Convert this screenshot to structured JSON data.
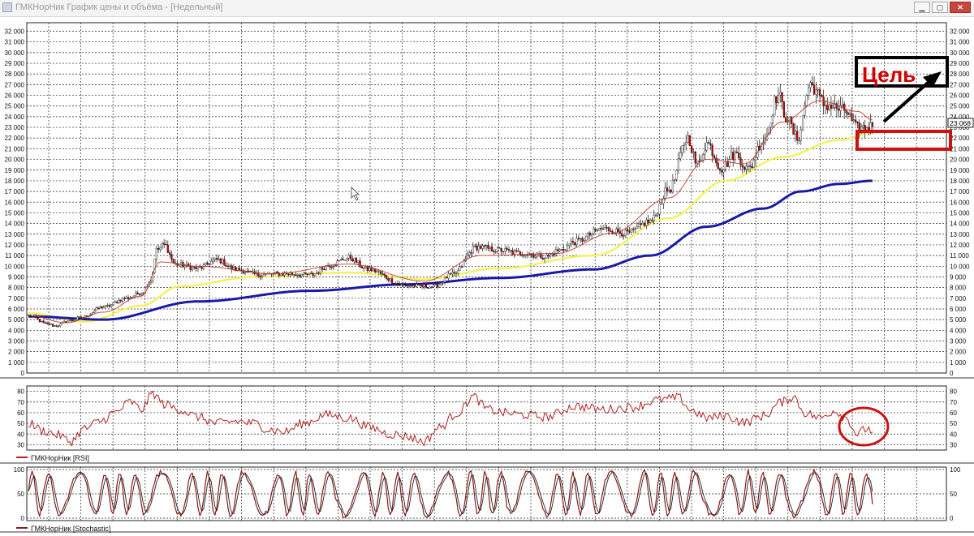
{
  "window": {
    "title": "ГМКНорНик График цены и объёма - [Недельный]",
    "minimize_glyph": "▁",
    "maximize_glyph": "▢",
    "close_glyph": "✕",
    "icon": "chart-window-icon"
  },
  "annotation": {
    "target_label": "Цель",
    "price_label": "23 068"
  },
  "colors": {
    "candle_up": "#ffffff",
    "candle_down": "#cc0000",
    "candle_wick": "#111111",
    "ma_short": "#c0392b",
    "ma_mid": "#f2f25a",
    "ma_long": "#1a1aa6",
    "rsi_line": "#b22222",
    "stoch_k": "#8b1a1a",
    "stoch_d": "#222222",
    "annotation": "#d10000",
    "grid": "#222222"
  },
  "chart_data": [
    {
      "type": "candlestick",
      "name": "price",
      "y_ticks": [
        0,
        1000,
        2000,
        3000,
        4000,
        5000,
        6000,
        7000,
        8000,
        9000,
        10000,
        11000,
        12000,
        13000,
        14000,
        15000,
        16000,
        17000,
        18000,
        19000,
        20000,
        21000,
        22000,
        23000,
        24000,
        25000,
        26000,
        27000,
        28000,
        29000,
        30000,
        31000,
        32000
      ],
      "y_tick_labels": [
        "0",
        "1 000",
        "2 000",
        "3 000",
        "4 000",
        "5 000",
        "6 000",
        "7 000",
        "8 000",
        "9 000",
        "10 000",
        "11 000",
        "12 000",
        "13 000",
        "14 000",
        "15 000",
        "16 000",
        "17 000",
        "18 000",
        "19 000",
        "20 000",
        "21 000",
        "22 000",
        "23 000",
        "24 000",
        "25 000",
        "26 000",
        "27 000",
        "28 000",
        "29 000",
        "30 000",
        "31 000",
        "32 000"
      ],
      "ylim": [
        0,
        32800
      ],
      "grid": true,
      "last_price": 23068,
      "close_anchors": [
        [
          0,
          5400
        ],
        [
          10,
          4600
        ],
        [
          14,
          4400
        ],
        [
          22,
          4900
        ],
        [
          28,
          5200
        ],
        [
          40,
          6200
        ],
        [
          52,
          7000
        ],
        [
          60,
          7500
        ],
        [
          65,
          8700
        ],
        [
          68,
          11500
        ],
        [
          72,
          12000
        ],
        [
          78,
          10200
        ],
        [
          90,
          9800
        ],
        [
          100,
          10600
        ],
        [
          110,
          9700
        ],
        [
          122,
          9200
        ],
        [
          135,
          9300
        ],
        [
          150,
          9200
        ],
        [
          160,
          10100
        ],
        [
          170,
          10800
        ],
        [
          180,
          9700
        ],
        [
          200,
          8200
        ],
        [
          215,
          8100
        ],
        [
          225,
          9200
        ],
        [
          238,
          11800
        ],
        [
          250,
          11500
        ],
        [
          262,
          11200
        ],
        [
          275,
          10900
        ],
        [
          282,
          11500
        ],
        [
          290,
          12300
        ],
        [
          305,
          13500
        ],
        [
          318,
          13100
        ],
        [
          330,
          14200
        ],
        [
          340,
          17200
        ],
        [
          350,
          22000
        ],
        [
          355,
          19500
        ],
        [
          360,
          21500
        ],
        [
          368,
          19200
        ],
        [
          375,
          20500
        ],
        [
          382,
          19100
        ],
        [
          390,
          21800
        ],
        [
          398,
          26000
        ],
        [
          402,
          24000
        ],
        [
          408,
          22000
        ],
        [
          415,
          27000
        ],
        [
          423,
          25100
        ],
        [
          433,
          24600
        ],
        [
          440,
          22900
        ],
        [
          448,
          23068
        ]
      ],
      "sma_short_anchors": [
        [
          0,
          5400
        ],
        [
          20,
          4700
        ],
        [
          40,
          5700
        ],
        [
          60,
          7200
        ],
        [
          70,
          10400
        ],
        [
          90,
          10000
        ],
        [
          130,
          9300
        ],
        [
          170,
          10200
        ],
        [
          210,
          8600
        ],
        [
          240,
          11000
        ],
        [
          280,
          11200
        ],
        [
          310,
          13100
        ],
        [
          340,
          16400
        ],
        [
          360,
          20000
        ],
        [
          380,
          19600
        ],
        [
          400,
          23500
        ],
        [
          420,
          25500
        ],
        [
          440,
          24500
        ],
        [
          448,
          23700
        ]
      ],
      "sma_mid_anchors": [
        [
          0,
          5600
        ],
        [
          30,
          4800
        ],
        [
          60,
          6300
        ],
        [
          80,
          8100
        ],
        [
          120,
          9000
        ],
        [
          170,
          9400
        ],
        [
          210,
          8800
        ],
        [
          250,
          9800
        ],
        [
          300,
          11000
        ],
        [
          340,
          14500
        ],
        [
          370,
          18000
        ],
        [
          400,
          20200
        ],
        [
          430,
          21800
        ],
        [
          448,
          22500
        ]
      ],
      "sma_long_anchors": [
        [
          0,
          5300
        ],
        [
          40,
          5000
        ],
        [
          90,
          6700
        ],
        [
          150,
          7700
        ],
        [
          200,
          8300
        ],
        [
          250,
          8900
        ],
        [
          300,
          9700
        ],
        [
          330,
          11000
        ],
        [
          360,
          13700
        ],
        [
          390,
          15400
        ],
        [
          410,
          17000
        ],
        [
          430,
          17700
        ],
        [
          448,
          18000
        ]
      ]
    },
    {
      "type": "line",
      "name": "rsi",
      "legend": "ГМКНорНик [RSI]",
      "y_ticks": [
        30,
        40,
        50,
        60,
        70,
        80
      ],
      "y_tick_labels": [
        "30",
        "40",
        "50",
        "60",
        "70",
        "80"
      ],
      "ylim": [
        25,
        85
      ],
      "anchors": [
        [
          0,
          50
        ],
        [
          8,
          43
        ],
        [
          16,
          39
        ],
        [
          22,
          33
        ],
        [
          30,
          45
        ],
        [
          38,
          52
        ],
        [
          46,
          60
        ],
        [
          54,
          70
        ],
        [
          60,
          63
        ],
        [
          66,
          78
        ],
        [
          72,
          68
        ],
        [
          80,
          63
        ],
        [
          90,
          56
        ],
        [
          100,
          50
        ],
        [
          110,
          52
        ],
        [
          120,
          50
        ],
        [
          128,
          44
        ],
        [
          136,
          42
        ],
        [
          146,
          50
        ],
        [
          158,
          58
        ],
        [
          170,
          55
        ],
        [
          182,
          46
        ],
        [
          192,
          40
        ],
        [
          200,
          38
        ],
        [
          210,
          33
        ],
        [
          218,
          46
        ],
        [
          228,
          60
        ],
        [
          236,
          75
        ],
        [
          244,
          63
        ],
        [
          252,
          60
        ],
        [
          262,
          58
        ],
        [
          275,
          56
        ],
        [
          290,
          66
        ],
        [
          305,
          63
        ],
        [
          320,
          65
        ],
        [
          335,
          72
        ],
        [
          345,
          74
        ],
        [
          352,
          62
        ],
        [
          360,
          55
        ],
        [
          370,
          57
        ],
        [
          380,
          51
        ],
        [
          390,
          57
        ],
        [
          400,
          70
        ],
        [
          406,
          75
        ],
        [
          412,
          60
        ],
        [
          420,
          55
        ],
        [
          428,
          62
        ],
        [
          434,
          55
        ],
        [
          440,
          40
        ],
        [
          445,
          45
        ],
        [
          448,
          43
        ]
      ]
    },
    {
      "type": "line",
      "name": "stochastic",
      "legend": "ГМКНорНик [Stochastic]",
      "y_ticks": [
        0,
        50,
        100
      ],
      "y_tick_labels": [
        "0",
        "50",
        "100"
      ],
      "ylim": [
        -5,
        105
      ]
    }
  ]
}
